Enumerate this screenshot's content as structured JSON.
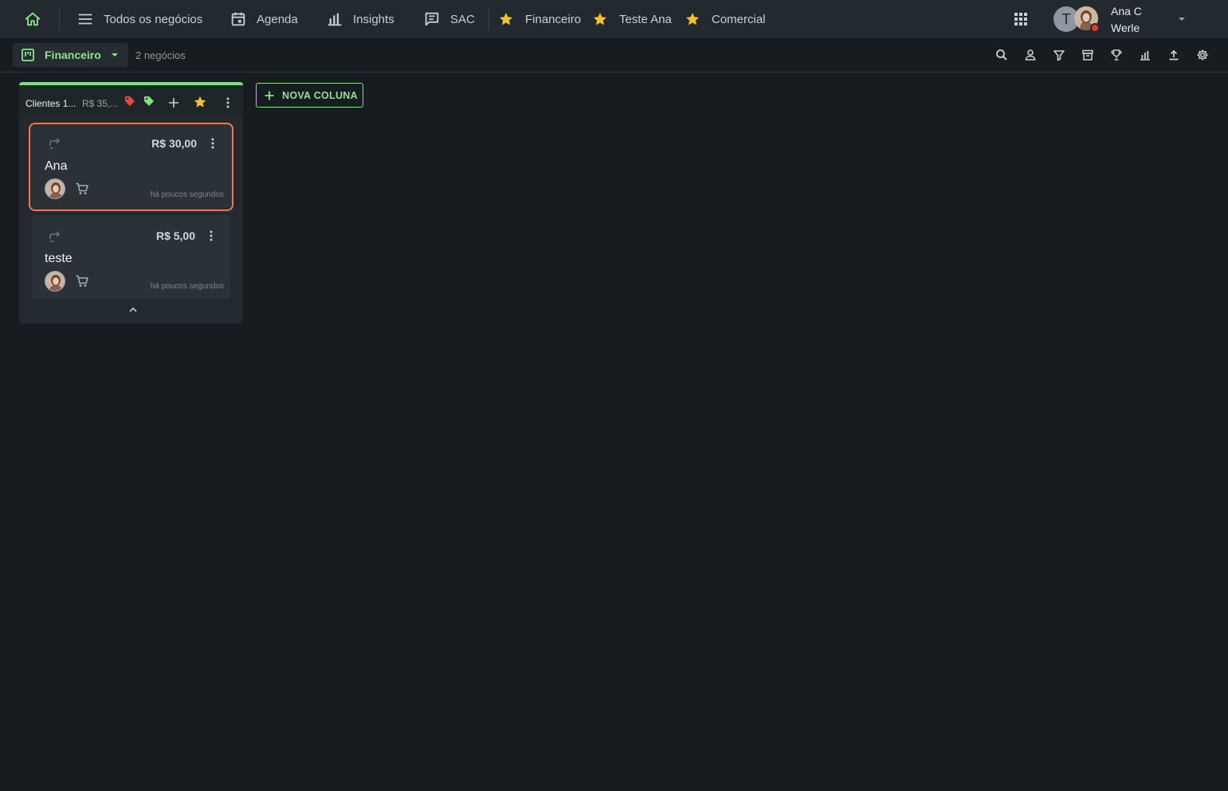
{
  "nav": {
    "home_icon": "home-icon",
    "items": [
      {
        "label": "Todos os negócios",
        "icon": "menu-icon"
      },
      {
        "label": "Agenda",
        "icon": "calendar-icon"
      },
      {
        "label": "Insights",
        "icon": "bar-chart-icon"
      },
      {
        "label": "SAC",
        "icon": "chat-icon"
      }
    ],
    "favorites": [
      {
        "label": "Financeiro",
        "icon": "star-icon"
      },
      {
        "label": "Teste Ana",
        "icon": "star-icon"
      },
      {
        "label": "Comercial",
        "icon": "star-icon"
      }
    ],
    "apps_icon": "apps-grid-icon",
    "user": {
      "initial": "T",
      "name_line1": "Ana C",
      "name_line2": "Werle",
      "status_color": "#e53935"
    }
  },
  "toolbar": {
    "pipeline": "Financeiro",
    "deal_count": "2 negócios",
    "tools": [
      "search-icon",
      "person-icon",
      "filter-icon",
      "archive-icon",
      "trophy-icon",
      "bar-chart-icon",
      "upload-icon",
      "gear-icon"
    ]
  },
  "column": {
    "title": "Clientes 1...",
    "total": "R$ 35,...",
    "accent_color": "#7ee07e",
    "tags": [
      "red-tag-icon",
      "green-tag-icon"
    ],
    "cards": [
      {
        "value": "R$ 30,00",
        "title": "Ana",
        "time": "há poucos segundos",
        "selected": true
      },
      {
        "value": "R$ 5,00",
        "title": "teste",
        "time": "há poucos segundos",
        "selected": false
      }
    ]
  },
  "new_column_label": "NOVA COLUNA",
  "colors": {
    "background": "#161c20",
    "topbar": "#232a2f",
    "accent_green": "#8ee48e",
    "star_yellow": "#fbc02d",
    "selected_border": "#ff7043"
  }
}
